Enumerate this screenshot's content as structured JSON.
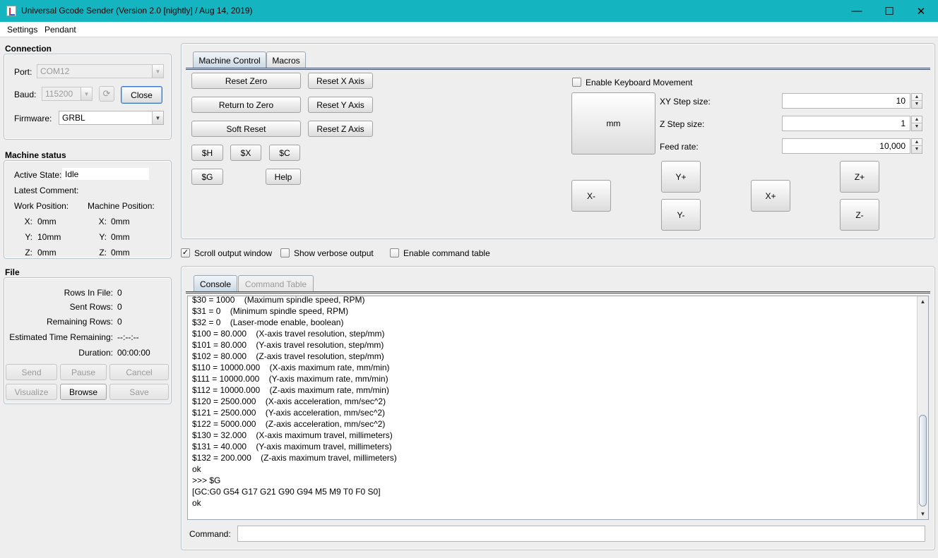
{
  "window": {
    "title": "Universal Gcode Sender (Version 2.0 [nightly]  / Aug 14, 2019)",
    "minimize": "—",
    "maximize": "☐",
    "close": "✕",
    "titlebar_color": "#14b4c0"
  },
  "menu": {
    "items": [
      "Settings",
      "Pendant"
    ]
  },
  "connection": {
    "title": "Connection",
    "port_label": "Port:",
    "port_value": "COM12",
    "baud_label": "Baud:",
    "baud_value": "115200",
    "close_button": "Close",
    "firmware_label": "Firmware:",
    "firmware_value": "GRBL"
  },
  "machine_status": {
    "title": "Machine status",
    "active_state_label": "Active State:",
    "active_state_value": "Idle",
    "latest_comment_label": "Latest Comment:",
    "work_position_label": "Work Position:",
    "machine_position_label": "Machine Position:",
    "work": {
      "x_label": "X:",
      "x": "0mm",
      "y_label": "Y:",
      "y": "10mm",
      "z_label": "Z:",
      "z": "0mm"
    },
    "machine": {
      "x_label": "X:",
      "x": "0mm",
      "y_label": "Y:",
      "y": "0mm",
      "z_label": "Z:",
      "z": "0mm"
    }
  },
  "file": {
    "title": "File",
    "rows_in_file_label": "Rows In File:",
    "rows_in_file": "0",
    "sent_rows_label": "Sent Rows:",
    "sent_rows": "0",
    "remaining_rows_label": "Remaining Rows:",
    "remaining_rows": "0",
    "estimated_time_label": "Estimated Time Remaining:",
    "estimated_time": "--:--:--",
    "duration_label": "Duration:",
    "duration": "00:00:00",
    "buttons": {
      "send": "Send",
      "pause": "Pause",
      "cancel": "Cancel",
      "visualize": "Visualize",
      "browse": "Browse",
      "save": "Save"
    }
  },
  "tabs_top": {
    "machine_control": "Machine Control",
    "macros": "Macros"
  },
  "machine_control": {
    "reset_zero": "Reset Zero",
    "return_to_zero": "Return to Zero",
    "soft_reset": "Soft Reset",
    "reset_x": "Reset X Axis",
    "reset_y": "Reset Y Axis",
    "reset_z": "Reset Z Axis",
    "cmd_h": "$H",
    "cmd_x": "$X",
    "cmd_c": "$C",
    "cmd_g": "$G",
    "help": "Help"
  },
  "jog": {
    "enable_keyboard_label": "Enable Keyboard Movement",
    "units_button": "mm",
    "xy_step_label": "XY Step size:",
    "xy_step_value": "10",
    "z_step_label": "Z Step size:",
    "z_step_value": "1",
    "feed_rate_label": "Feed rate:",
    "feed_rate_value": "10,000",
    "x_minus": "X-",
    "x_plus": "X+",
    "y_plus": "Y+",
    "y_minus": "Y-",
    "z_plus": "Z+",
    "z_minus": "Z-"
  },
  "options": {
    "scroll_output_label": "Scroll output window",
    "scroll_output_checked": "✓",
    "verbose_label": "Show verbose output",
    "command_table_label": "Enable command table"
  },
  "tabs_bottom": {
    "console": "Console",
    "command_table": "Command Table"
  },
  "console": {
    "lines": [
      "$30 = 1000    (Maximum spindle speed, RPM)",
      "$31 = 0    (Minimum spindle speed, RPM)",
      "$32 = 0    (Laser-mode enable, boolean)",
      "$100 = 80.000    (X-axis travel resolution, step/mm)",
      "$101 = 80.000    (Y-axis travel resolution, step/mm)",
      "$102 = 80.000    (Z-axis travel resolution, step/mm)",
      "$110 = 10000.000    (X-axis maximum rate, mm/min)",
      "$111 = 10000.000    (Y-axis maximum rate, mm/min)",
      "$112 = 10000.000    (Z-axis maximum rate, mm/min)",
      "$120 = 2500.000    (X-axis acceleration, mm/sec^2)",
      "$121 = 2500.000    (Y-axis acceleration, mm/sec^2)",
      "$122 = 5000.000    (Z-axis acceleration, mm/sec^2)",
      "$130 = 32.000    (X-axis maximum travel, millimeters)",
      "$131 = 40.000    (Y-axis maximum travel, millimeters)",
      "$132 = 200.000    (Z-axis maximum travel, millimeters)",
      "ok",
      ">>> $G",
      "[GC:G0 G54 G17 G21 G90 G94 M5 M9 T0 F0 S0]",
      "ok"
    ],
    "command_label": "Command:",
    "command_value": ""
  }
}
